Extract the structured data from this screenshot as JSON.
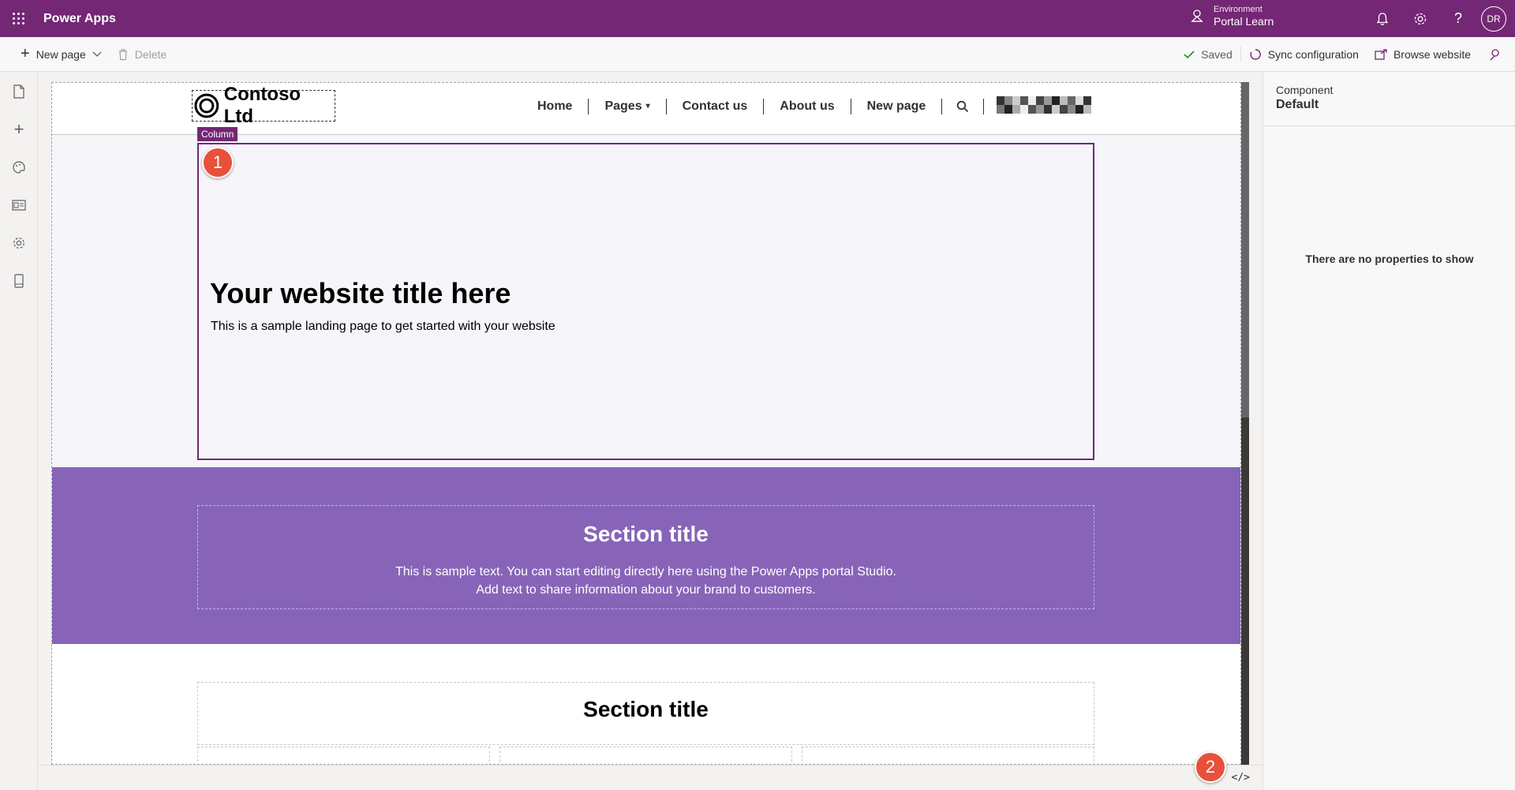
{
  "app": {
    "title": "Power Apps"
  },
  "environment": {
    "label": "Environment",
    "name": "Portal Learn"
  },
  "user": {
    "initials": "DR"
  },
  "topbar_icons": [
    "bell-icon",
    "gear-icon",
    "help-icon"
  ],
  "toolbar": {
    "new_page": "New page",
    "delete": "Delete",
    "saved": "Saved",
    "sync": "Sync configuration",
    "browse": "Browse website"
  },
  "left_rail": [
    "pages-icon",
    "add-icon",
    "theme-icon",
    "templates-icon",
    "settings-icon",
    "mobile-icon"
  ],
  "site": {
    "brand": "Contoso Ltd",
    "nav": [
      "Home",
      "Pages",
      "Contact us",
      "About us",
      "New page"
    ],
    "column_tag": "Column",
    "hero_title": "Your website title here",
    "hero_sub": "This is a sample landing page to get started with your website",
    "section1_title": "Section title",
    "section1_line1": "This is sample text. You can start editing directly here using the Power Apps portal Studio.",
    "section1_line2": "Add text to share information about your brand to customers.",
    "section2_title": "Section title"
  },
  "callouts": [
    "1",
    "2"
  ],
  "code_toggle": "</>",
  "properties": {
    "label": "Component",
    "value": "Default",
    "empty": "There are no properties to show"
  },
  "colors": {
    "brand": "#742774",
    "section": "#8764b8",
    "callout": "#e8503a"
  }
}
